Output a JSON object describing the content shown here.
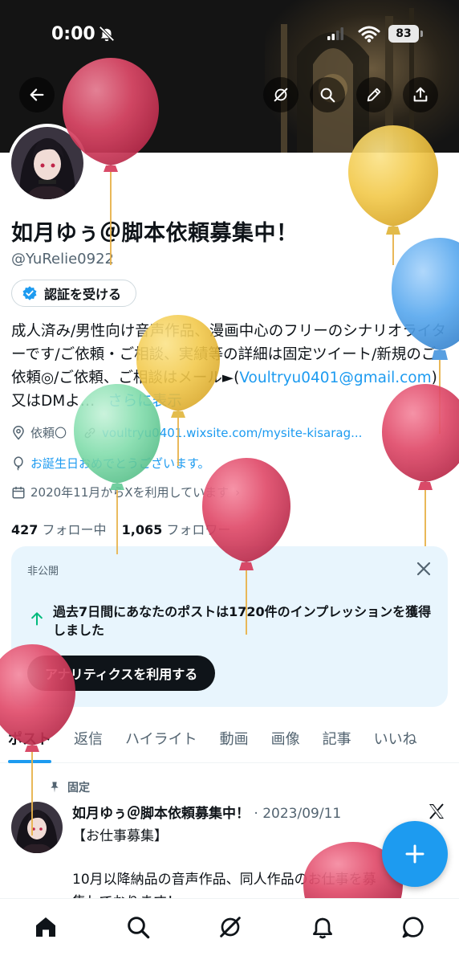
{
  "status_bar": {
    "time": "0:00",
    "battery": "83"
  },
  "banner": {
    "icons": [
      "back-arrow-icon",
      "grok-icon",
      "search-icon",
      "pencil-icon",
      "share-icon"
    ]
  },
  "profile": {
    "display_name": "如月ゆぅ＠脚本依頼募集中！",
    "handle": "@YuRelie0922",
    "verify_button": "認証を受ける",
    "bio": {
      "text": "成人済み/男性向け音声作品、漫画中心のフリーのシナリオライターです/ご依頼・ご相談、実績等の詳細は固定ツイート/新規のご依頼◎/ご依頼、ご相談はメール►(",
      "email": "Voultryu0401@gmail.com",
      "suffix": ") 又はDMよ…",
      "more": "さらに表示"
    },
    "location": "依頼〇",
    "website": "voultryu0401.wixsite.com/mysite-kisarag...",
    "birthday": "お誕生日おめでとうございます。",
    "joined": "2020年11月からXを利用しています",
    "following_count": "427",
    "following_label": "フォロー中",
    "followers_count": "1,065",
    "followers_label": "フォロワー"
  },
  "analytics_card": {
    "private_label": "非公開",
    "message": "過去7日間にあなたのポストは1720件のインプレッションを獲得しました",
    "button": "アナリティクスを利用する"
  },
  "tabs": [
    {
      "label": "ポスト",
      "active": true
    },
    {
      "label": "返信",
      "active": false
    },
    {
      "label": "ハイライト",
      "active": false
    },
    {
      "label": "動画",
      "active": false
    },
    {
      "label": "画像",
      "active": false
    },
    {
      "label": "記事",
      "active": false
    },
    {
      "label": "いいね",
      "active": false
    }
  ],
  "pinned_post": {
    "pinned_label": "固定",
    "author": "如月ゆぅ＠脚本依頼募集中！",
    "date": "· 2023/09/11",
    "line1": "【お仕事募集】",
    "line2": "10月以降納品の音声作品、同人作品のお仕事を募",
    "line3": "集しております！"
  },
  "bottom_nav": [
    "home-icon",
    "search-icon",
    "grok-icon",
    "bell-icon",
    "messages-icon"
  ],
  "colors": {
    "accent": "#1d9bf0",
    "card_bg": "#e8f5fd",
    "balloon_red": "#e04b6a",
    "balloon_yellow": "#f2c94c",
    "balloon_blue": "#5aa9ee",
    "balloon_green": "#7fdcaa"
  }
}
